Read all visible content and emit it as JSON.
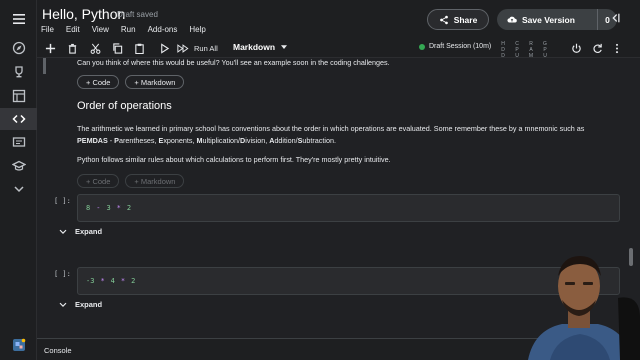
{
  "header": {
    "title": "Hello, Python",
    "draft_status": "Draft saved",
    "menu": [
      "File",
      "Edit",
      "View",
      "Run",
      "Add-ons",
      "Help"
    ],
    "share_label": "Share",
    "save_version_label": "Save Version",
    "save_version_count": "0"
  },
  "toolbar": {
    "run_all_label": "Run All",
    "cell_type": "Markdown",
    "session_label": "Draft Session (10m)",
    "meters": [
      "H D D",
      "C P U",
      "R A M",
      "G P U"
    ]
  },
  "notebook": {
    "intro_text": "Can you think of where this would be useful? You'll see an example soon in the coding challenges.",
    "add_code_label": "+ Code",
    "add_markdown_label": "+ Markdown",
    "heading": "Order of operations",
    "para1": "The arithmetic we learned in primary school has conventions about the order in which operations are evaluated. Some remember these by a mnemonic such as",
    "pemdas": {
      "acronym": "PEMDAS",
      "sep": " - ",
      "words": [
        {
          "initial": "P",
          "rest": "arentheses"
        },
        {
          "initial": "E",
          "rest": "xponents"
        },
        {
          "initial": "M",
          "rest": "ultiplication"
        },
        {
          "initial": "D",
          "rest": "ivision"
        },
        {
          "initial": "A",
          "rest": "ddition"
        },
        {
          "initial": "S",
          "rest": "ubtraction"
        }
      ]
    },
    "para2": "Python follows similar rules about which calculations to perform first. They're mostly pretty intuitive.",
    "cells": [
      {
        "prompt": "[ ]:",
        "tokens": [
          "8",
          "-",
          "3",
          "*",
          "2"
        ],
        "expand_label": "Expand"
      },
      {
        "prompt": "[ ]:",
        "tokens": [
          "-3",
          "*",
          "4",
          "*",
          "2"
        ],
        "expand_label": "Expand"
      }
    ]
  },
  "console": {
    "label": "Console"
  },
  "colors": {
    "number": "#81c995",
    "operator": "#c58af9",
    "session_dot": "#34a853"
  }
}
